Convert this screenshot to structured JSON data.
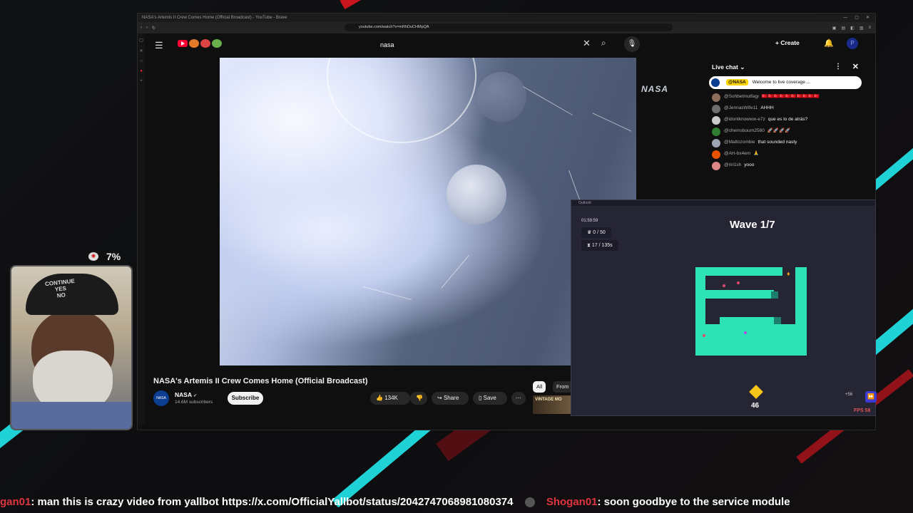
{
  "browser": {
    "window_title": "NASA's Artemis II Crew Comes Home (Official Broadcast) - YouTube - Brave",
    "url": "youtube.com/watch?v=mRhDuCHMpQA"
  },
  "youtube": {
    "search_value": "nasa",
    "create_label": "Create",
    "video_title": "NASA's Artemis II Crew Comes Home (Official Broadcast)",
    "channel_name": "NASA",
    "channel_avatar_text": "NASA",
    "subscribers": "14.6M subscribers",
    "subscribe_label": "Subscribe",
    "like_count": "134K",
    "share_label": "Share",
    "save_label": "Save",
    "chip_all": "All",
    "chip_from": "From",
    "thumb_text": "VINTAGE MO",
    "watermark": "NASA"
  },
  "chat": {
    "header": "Live chat",
    "pinned_author": "@NASA",
    "pinned_text": "Welcome to live coverage ...",
    "messages": [
      {
        "author": "@Sohbetmutfagı",
        "text": "🇹🇷🇹🇷🇹🇷🇹🇷🇹🇷🇹🇷🇹🇷🇹🇷🇹🇷🇹🇷",
        "color": "#8a6d5a"
      },
      {
        "author": "@JennasWife11",
        "text": "AHHH",
        "color": "#6d6d6d"
      },
      {
        "author": "@idontknowww-e7z",
        "text": "que es lo de atrás?",
        "color": "#c9c9c9"
      },
      {
        "author": "@chemsbourn2580",
        "text": "🚀🚀🚀🚀",
        "color": "#2e7d32"
      },
      {
        "author": "@Maltozombie",
        "text": "that sounded nasty",
        "color": "#9aa4b5"
      },
      {
        "author": "@AH-bx4em",
        "text": "🙏",
        "color": "#e65100"
      },
      {
        "author": "@riri1sh",
        "text": "yooo",
        "color": "#d88"
      }
    ]
  },
  "game": {
    "window_title": "Outhold",
    "timer": "01:59:59",
    "kills": "0 / 50",
    "hourglass": "17 / 135s",
    "wave": "Wave 1/7",
    "coins": "46",
    "speed_label": "+56",
    "fps": "FPS 58",
    "maze_color": "#2de3b5"
  },
  "stream": {
    "cpu_percent": "7%",
    "cap_text_line1": "CONTINUE",
    "cap_text_line2": "YES",
    "cap_text_line3": "NO",
    "ticker": [
      {
        "user": "gan01",
        "message": ": man this is crazy video from yallbot https://x.com/OfficialYallbot/status/2042747068981080374"
      },
      {
        "user": "Shogan01",
        "message": ": soon goodbye to the service module"
      }
    ],
    "accent_teal": "#1fd2d6",
    "accent_red": "#c8141c"
  }
}
